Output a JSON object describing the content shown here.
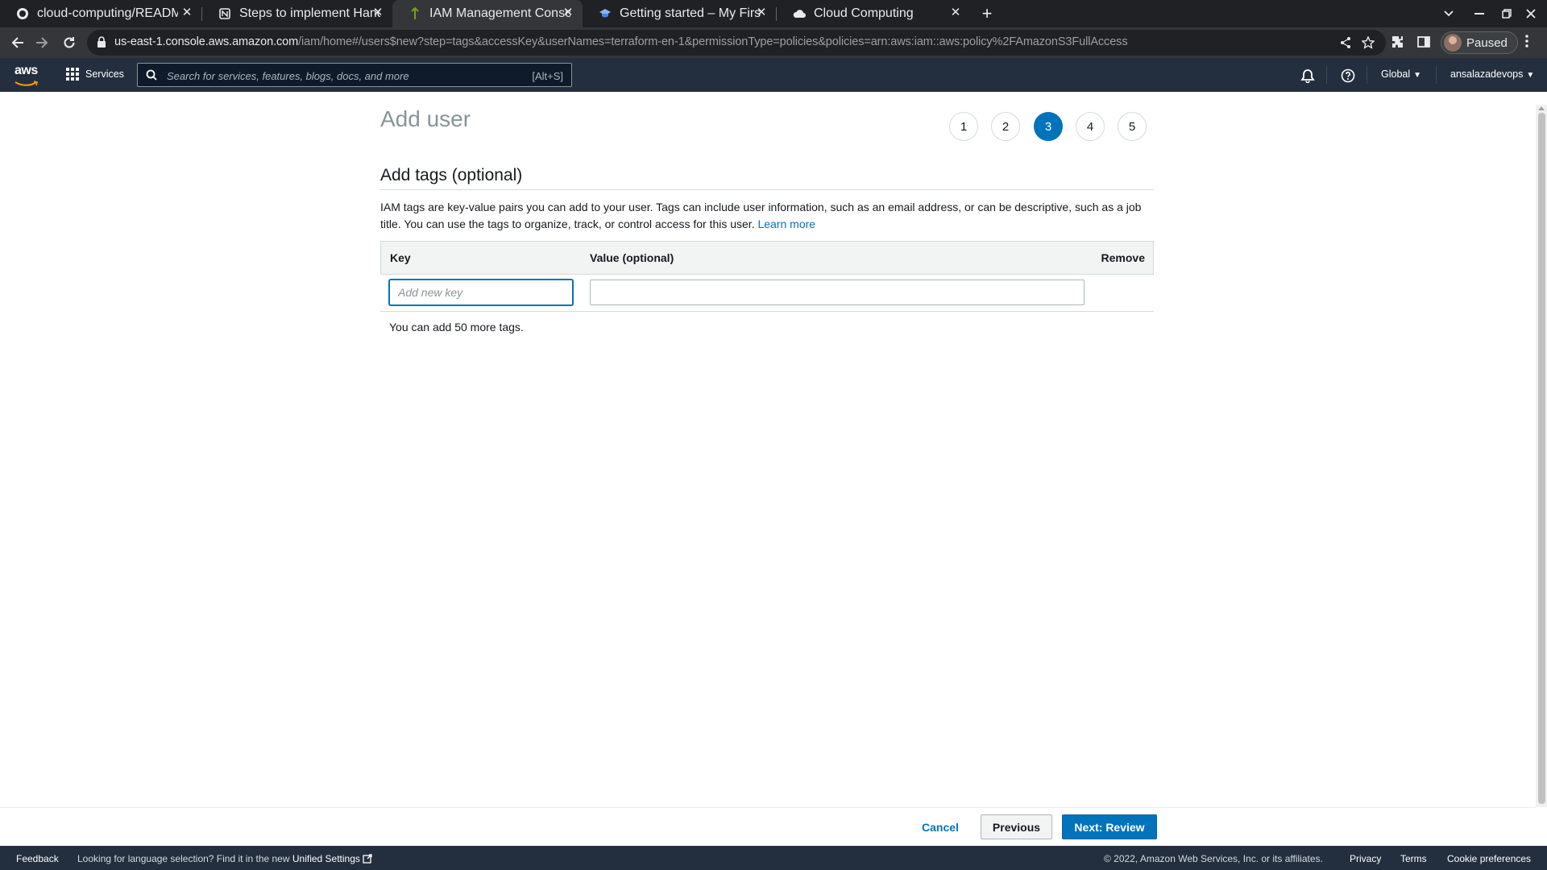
{
  "browser": {
    "tabs": [
      {
        "title": "cloud-computing/READM",
        "icon": "github-icon"
      },
      {
        "title": "Steps to implement Hand",
        "icon": "notion-icon"
      },
      {
        "title": "IAM Management Consol",
        "icon": "iam-icon",
        "active": true
      },
      {
        "title": "Getting started – My First",
        "icon": "graduation-cap-icon"
      },
      {
        "title": "Cloud Computing",
        "icon": "cloud-icon"
      }
    ],
    "url_host": "us-east-1.console.aws.amazon.com",
    "url_path": "/iam/home#/users$new?step=tags&accessKey&userNames=terraform-en-1&permissionType=policies&policies=arn:aws:iam::aws:policy%2FAmazonS3FullAccess",
    "profile_label": "Paused"
  },
  "aws_header": {
    "logo_text": "aws",
    "services_label": "Services",
    "search_placeholder": "Search for services, features, blogs, docs, and more",
    "search_shortcut": "[Alt+S]",
    "region_label": "Global",
    "account_label": "ansalazadevops"
  },
  "main": {
    "title": "Add user",
    "steps": [
      "1",
      "2",
      "3",
      "4",
      "5"
    ],
    "active_step": "3",
    "section_title": "Add tags (optional)",
    "description": "IAM tags are key-value pairs you can add to your user. Tags can include user information, such as an email address, or can be descriptive, such as a job title. You can use the tags to organize, track, or control access for this user.",
    "learn_more": "Learn more",
    "table": {
      "columns": [
        "Key",
        "Value (optional)",
        "Remove"
      ],
      "key_placeholder": "Add new key",
      "value_value": ""
    },
    "remaining_tags": "You can add 50 more tags."
  },
  "actions": {
    "cancel": "Cancel",
    "previous": "Previous",
    "next": "Next: Review"
  },
  "footer": {
    "feedback": "Feedback",
    "language_text": "Looking for language selection? Find it in the new",
    "unified_settings": "Unified Settings",
    "copyright": "© 2022, Amazon Web Services, Inc. or its affiliates.",
    "privacy": "Privacy",
    "terms": "Terms",
    "cookie": "Cookie preferences"
  },
  "colors": {
    "aws_nav": "#232f3e",
    "accent": "#0073bb",
    "aws_orange": "#ff9900"
  }
}
